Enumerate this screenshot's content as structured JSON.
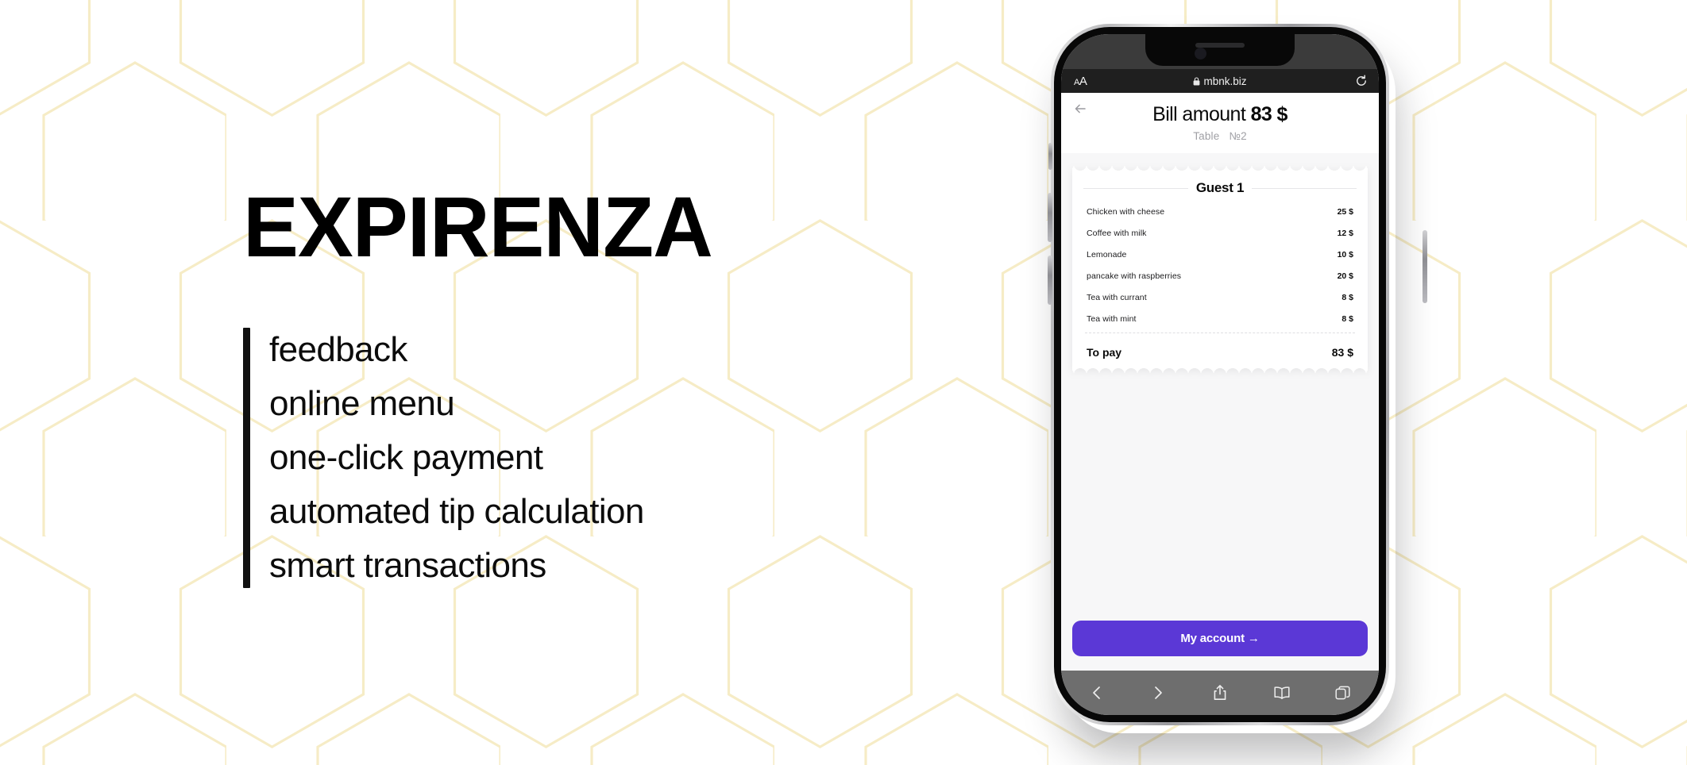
{
  "promo": {
    "brand": "EXPIRENZA",
    "features": [
      "feedback",
      "online menu",
      "one-click payment",
      "automated tip calculation",
      "smart transactions"
    ]
  },
  "theme": {
    "accent_purple": "#5b38d6",
    "hex_line": "#f7eec8",
    "page_bg": "#f7f7f8",
    "text_dark": "#0a0a0a",
    "muted": "#a0a0a5"
  },
  "phone": {
    "browser": {
      "text_size_button": "AA",
      "url": "mbnk.biz",
      "lock_icon": "lock-icon",
      "reload_icon": "reload-icon",
      "toolbar": [
        {
          "name": "back",
          "icon": "chevron-left-icon"
        },
        {
          "name": "forward",
          "icon": "chevron-right-icon"
        },
        {
          "name": "share",
          "icon": "share-icon"
        },
        {
          "name": "bookmarks",
          "icon": "book-icon"
        },
        {
          "name": "tabs",
          "icon": "tabs-icon"
        }
      ]
    },
    "screen": {
      "back_icon": "arrow-left-icon",
      "title_label": "Bill amount",
      "title_amount": "83 $",
      "subtitle_label": "Table",
      "subtitle_value": "№2",
      "receipt": {
        "guest_label": "Guest 1",
        "items": [
          {
            "name": "Chicken with cheese",
            "price": "25 $"
          },
          {
            "name": "Coffee with milk",
            "price": "12 $"
          },
          {
            "name": "Lemonade",
            "price": "10 $"
          },
          {
            "name": "pancake with raspberries",
            "price": "20 $"
          },
          {
            "name": "Tea with currant",
            "price": "8 $"
          },
          {
            "name": "Tea with mint",
            "price": "8 $"
          }
        ],
        "total_label": "To pay",
        "total_value": "83 $"
      },
      "cta_label": "My account  →"
    }
  }
}
